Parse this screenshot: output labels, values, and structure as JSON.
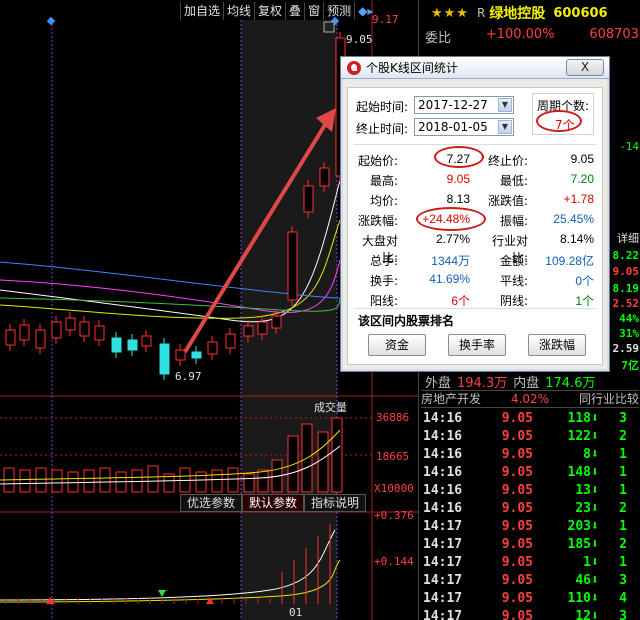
{
  "toolbar": {
    "items": [
      "加自选",
      "均线",
      "复权",
      "叠",
      "窗",
      "预测"
    ],
    "price_top": "9.17"
  },
  "chart": {
    "high_label": "9.05",
    "low_label": "6.97",
    "volume_title": "成交量",
    "volume_max": "36886",
    "volume_mid": "18665",
    "volume_unit": "X10000",
    "indicator_max": "+0.376",
    "indicator_mid": "+0.144",
    "date_label": "01",
    "param_tabs": [
      "优选参数",
      "默认参数",
      "指标说明"
    ]
  },
  "quote": {
    "stars": "★★★",
    "prefix": "R",
    "name": "绿地控股",
    "code": "600606",
    "weibi_label": "委比",
    "weibi_pct": "+100.00%",
    "weibi_val": "608703",
    "side_values": [
      "-14",
      "详细",
      "8.22",
      "9.05",
      "8.19",
      "2.52",
      "44%",
      "31%",
      "2.59",
      "7亿"
    ],
    "outer_label": "外盘",
    "outer_value": "194.3万",
    "inner_label": "内盘",
    "inner_value": "174.6万",
    "sector_name": "房地产开发",
    "sector_pct": "4.02%",
    "sector_btn": "同行业比较",
    "ticks": [
      {
        "t": "14:16",
        "p": "9.05",
        "v": "118",
        "x": "3"
      },
      {
        "t": "14:16",
        "p": "9.05",
        "v": "122",
        "x": "2"
      },
      {
        "t": "14:16",
        "p": "9.05",
        "v": "8",
        "x": "1"
      },
      {
        "t": "14:16",
        "p": "9.05",
        "v": "148",
        "x": "1"
      },
      {
        "t": "14:16",
        "p": "9.05",
        "v": "13",
        "x": "1"
      },
      {
        "t": "14:16",
        "p": "9.05",
        "v": "23",
        "x": "2"
      },
      {
        "t": "14:17",
        "p": "9.05",
        "v": "203",
        "x": "1"
      },
      {
        "t": "14:17",
        "p": "9.05",
        "v": "185",
        "x": "2"
      },
      {
        "t": "14:17",
        "p": "9.05",
        "v": "1",
        "x": "1"
      },
      {
        "t": "14:17",
        "p": "9.05",
        "v": "46",
        "x": "3"
      },
      {
        "t": "14:17",
        "p": "9.05",
        "v": "110",
        "x": "4"
      },
      {
        "t": "14:17",
        "p": "9.05",
        "v": "12",
        "x": "3"
      }
    ]
  },
  "dialog": {
    "title": "个股K线区间统计",
    "close": "X",
    "start_time_label": "起始时间:",
    "start_time": "2017-12-27",
    "end_time_label": "终止时间:",
    "end_time": "2018-01-05",
    "period_label": "周期个数:",
    "period_value": "7个",
    "stats": {
      "start_price_label": "起始价:",
      "start_price": "7.27",
      "end_price_label": "终止价:",
      "end_price": "9.05",
      "high_label": "最高:",
      "high": "9.05",
      "low_label": "最低:",
      "low": "7.20",
      "avg_label": "均价:",
      "avg": "8.13",
      "change_label": "涨跌值:",
      "change": "+1.78",
      "pct_label": "涨跌幅:",
      "pct": "+24.48%",
      "amp_label": "振幅:",
      "amp": "25.45%",
      "mkt_label": "大盘对比:",
      "mkt": "2.77%",
      "ind_label": "行业对比:",
      "ind": "8.14%",
      "vol_label": "总手:",
      "vol": "1344万",
      "amount_label": "金额:",
      "amount": "109.28亿",
      "turn_label": "换手:",
      "turn": "41.69%",
      "flat_label": "平线:",
      "flat": "0个",
      "up_label": "阳线:",
      "up": "6个",
      "down_label": "阴线:",
      "down": "1个"
    },
    "rank_title": "该区间内股票排名",
    "buttons": [
      "资金",
      "换手率",
      "涨跌幅"
    ]
  }
}
